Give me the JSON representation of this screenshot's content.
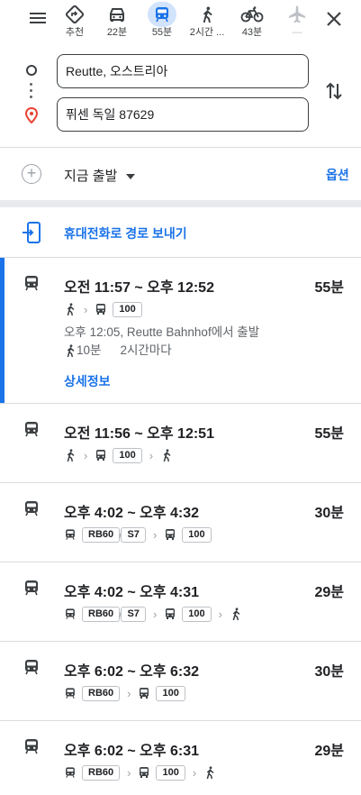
{
  "modes": [
    {
      "label": "추천"
    },
    {
      "label": "22분"
    },
    {
      "label": "55분"
    },
    {
      "label": "2시간 ..."
    },
    {
      "label": "43분"
    },
    {
      "label": "—"
    }
  ],
  "origin": {
    "value": "Reutte, 오스트리아"
  },
  "destination": {
    "value": "퓌센 독일 87629"
  },
  "depart": {
    "label": "지금 출발",
    "options_label": "옵션"
  },
  "send_to_phone": {
    "label": "휴대전화로 경로 보내기"
  },
  "routes": [
    {
      "time": "오전 11:57 ~ 오후 12:52",
      "duration": "55분",
      "bus": "100",
      "depart_info": "오후 12:05, Reutte Bahnhof에서 출발",
      "walk": "10분",
      "frequency": "2시간마다",
      "more": "상세정보"
    },
    {
      "time": "오전 11:56 ~ 오후 12:51",
      "duration": "55분",
      "bus": "100"
    },
    {
      "time": "오후 4:02 ~ 오후 4:32",
      "duration": "30분",
      "train1": "RB60",
      "train2": "S7",
      "bus": "100"
    },
    {
      "time": "오후 4:02 ~ 오후 4:31",
      "duration": "29분",
      "train1": "RB60",
      "train2": "S7",
      "bus": "100"
    },
    {
      "time": "오후 6:02 ~ 오후 6:32",
      "duration": "30분",
      "train1": "RB60",
      "bus": "100"
    },
    {
      "time": "오후 6:02 ~ 오후 6:31",
      "duration": "29분",
      "train1": "RB60",
      "bus": "100"
    }
  ],
  "colors": {
    "accent": "#1a73e8",
    "active_mode_bg": "#d2e3fc",
    "destination_pin": "#ea4335"
  },
  "icons": [
    "menu-icon",
    "directions-icon",
    "car-icon",
    "transit-icon",
    "walk-icon",
    "bike-icon",
    "flight-icon",
    "close-icon",
    "swap-icon",
    "add-icon",
    "phone-send-icon",
    "train-icon",
    "bus-icon"
  ]
}
